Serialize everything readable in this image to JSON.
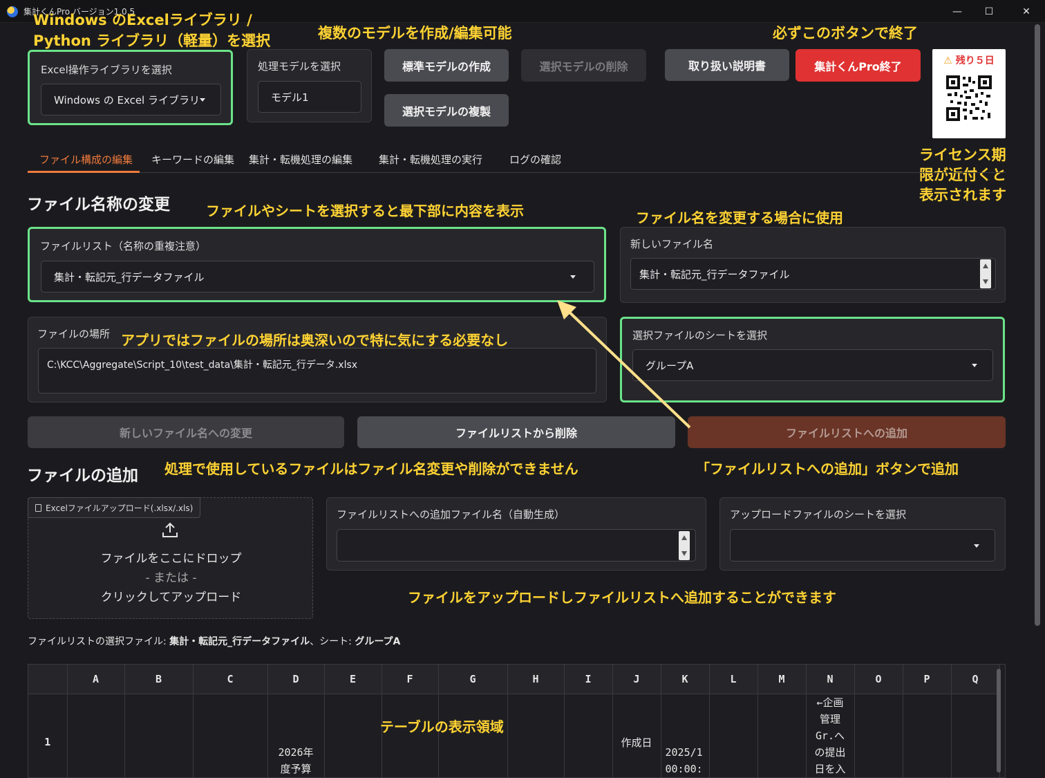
{
  "window": {
    "title": "集計くんPro バージョン1.0.5"
  },
  "annotations": {
    "lib_select": "Windows のExcelライブラリ / Python ライブラリ（軽量）を選択",
    "lib_select_line1": "Windows のExcelライブラリ /",
    "lib_select_line2": "Python ライブラリ（軽量）を選択",
    "models": "複数のモデルを作成/編集可能",
    "quit": "必ずこのボタンで終了",
    "license_line1": "ライセンス期",
    "license_line2": "限が近付くと",
    "license_line3": "表示されます",
    "select_info": "ファイルやシートを選択すると最下部に内容を表示",
    "rename_info": "ファイル名を変更する場合に使用",
    "location_info": "アプリではファイルの場所は奥深いので特に気にする必要なし",
    "in_use_info": "処理で使用しているファイルはファイル名変更や削除ができません",
    "add_info": "「ファイルリストへの追加」ボタンで追加",
    "upload_info": "ファイルをアップロードしファイルリストへ追加することができます",
    "table_info": "テーブルの表示領域"
  },
  "library": {
    "label": "Excel操作ライブラリを選択",
    "value": "Windows の Excel ライブラリ"
  },
  "model": {
    "label": "処理モデルを選択",
    "value": "モデル1"
  },
  "buttons": {
    "create_model": "標準モデルの作成",
    "delete_model": "選択モデルの削除",
    "duplicate_model": "選択モデルの複製",
    "manual": "取り扱い説明書",
    "quit": "集計くんPro終了",
    "rename": "新しいファイル名への変更",
    "remove": "ファイルリストから削除",
    "add": "ファイルリストへの追加"
  },
  "license": {
    "badge": "残り５日"
  },
  "tabs": [
    "ファイル構成の編集",
    "キーワードの編集",
    "集計・転機処理の編集",
    "集計・転機処理の実行",
    "ログの確認"
  ],
  "rename_section": {
    "title": "ファイル名称の変更",
    "file_list_label": "ファイルリスト（名称の重複注意）",
    "file_list_value": "集計・転記元_行データファイル",
    "new_name_label": "新しいファイル名",
    "new_name_value": "集計・転記元_行データファイル",
    "location_label": "ファイルの場所",
    "location_value": "C:\\KCC\\Aggregate\\Script_10\\test_data\\集計・転記元_行データ.xlsx",
    "sheet_label": "選択ファイルのシートを選択",
    "sheet_value": "グループA"
  },
  "add_section": {
    "title": "ファイルの追加",
    "upload_tab": "Excelファイルアップロード(.xlsx/.xls)",
    "drop_line1": "ファイルをここにドロップ",
    "drop_line2": "- または -",
    "drop_line3": "クリックしてアップロード",
    "add_name_label": "ファイルリストへの追加ファイル名（自動生成）",
    "add_name_value": "",
    "upload_sheet_label": "アップロードファイルのシートを選択",
    "upload_sheet_value": ""
  },
  "selection_status": {
    "prefix": "ファイルリストの選択ファイル: ",
    "file": "集計・転記元_行データファイル",
    "middle": "、シート: ",
    "sheet": "グループA"
  },
  "table": {
    "columns": [
      "",
      "A",
      "B",
      "C",
      "D",
      "E",
      "F",
      "G",
      "H",
      "I",
      "J",
      "K",
      "L",
      "M",
      "N",
      "O",
      "P",
      "Q"
    ],
    "row1": {
      "index": "1",
      "D_line1": "2026年",
      "D_line2": "度予算",
      "J": "作成日",
      "K_line1": "2025/1",
      "K_line2": "00:00:",
      "N_lines": [
        "←企画",
        "管理",
        "Gr.へ",
        "の提出",
        "日を入"
      ]
    }
  },
  "colors": {
    "accent_orange": "#f07a3c",
    "highlight_green": "#6be38a",
    "annotation_yellow": "#ffd333",
    "quit_red": "#e03232"
  }
}
